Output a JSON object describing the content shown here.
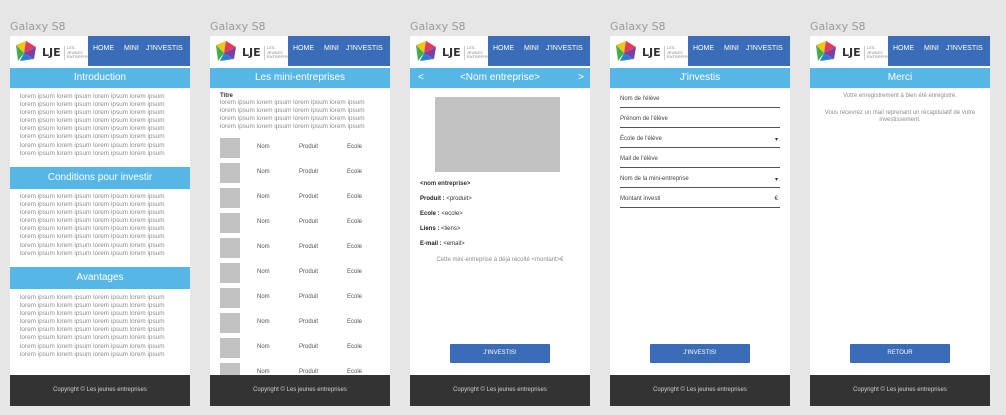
{
  "device_label": "Galaxy S8",
  "brand": {
    "logo_text": "LJE",
    "logo_sub": "LES JEUNES ENTREPRISES"
  },
  "nav": {
    "home": "HOME",
    "mini": "MINI",
    "invest": "J'INVESTIS"
  },
  "lorem_line": "lorem ipsum lorem ipsum lorem ipsum lorem ipsum lorem ipsum lorem ipsum lorem ipsum lorem ipsum lorem ipsum lorem ipsum lorem ipsum lorem ipsum lorem ipsum lorem ipsum lorem ipsum lorem ipsum lorem ipsum lorem ipsum lorem ipsum lorem ipsum lorem ipsum lorem ipsum lorem ipsum lorem ipsum lorem ipsum lorem ipsum lorem ipsum lorem ipsum lorem ipsum lorem ipsum lorem ipsum lorem ipsum lorem ipsum lorem ipsum lorem ipsum",
  "footer": "Copyright © Les jeunes entreprises",
  "screen1": {
    "introduction": "Introduction",
    "conditions": "Conditions pour investir",
    "avantages": "Avantages"
  },
  "screen2": {
    "title": "Les mini-entreprises",
    "list_title": "Titre",
    "list_text": "lorem ipsum lorem ipsum lorem ipsum lorem ipsum lorem ipsum lorem ipsum lorem ipsum lorem ipsum lorem ipsum lorem ipsum lorem ipsum lorem ipsum lorem ipsum lorem ipsum lorem ipsum lorem ipsum",
    "col_nom": "Nom",
    "col_produit": "Produit",
    "col_ecole": "Ecole"
  },
  "screen3": {
    "title": "<Nom entreprise>",
    "prev": "<",
    "next": ">",
    "name": "<nom entreprise>",
    "produit_label": "Produit :",
    "produit_value": "<produit>",
    "ecole_label": "Ecole :",
    "ecole_value": "<ecole>",
    "liens_label": "Liens :",
    "liens_value": "<liens>",
    "email_label": "E-mail :",
    "email_value": "<email>",
    "raised": "Cette mini-entreprise à déjà récolté <montant>€",
    "button": "J'INVESTIS!"
  },
  "screen4": {
    "title": "J'investis",
    "fields": [
      "Nom de l'élève",
      "Prénom de l'élève",
      "École de l'élève",
      "Mail de l'élève",
      "Nom de la mini-entreprise",
      "Montant investi"
    ],
    "dropdown": "▾",
    "euro": "€",
    "button": "J'INVESTIS!"
  },
  "screen5": {
    "title": "Merci",
    "line1": "Votre enregistrement à bien été enregistré.",
    "line2": "Vous recevrez un mail reprenant un récapitulatif de votre investissement.",
    "button": "RETOUR"
  },
  "colors": {
    "nav_blue": "#3b6cb7",
    "section_blue": "#56b7e6",
    "footer": "#333333"
  }
}
